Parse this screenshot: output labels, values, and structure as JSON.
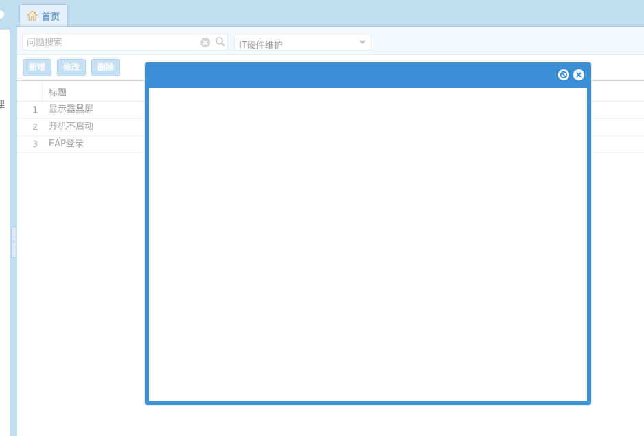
{
  "colors": {
    "accent": "#3a8fd4",
    "tabbar": "#c2dcf0",
    "button": "#c7e0f4"
  },
  "sidebar": {
    "partial_char": "理"
  },
  "tabs": [
    {
      "label": "首页",
      "icon": "home-icon"
    }
  ],
  "search": {
    "placeholder": "问题搜索",
    "value": ""
  },
  "category": {
    "selected": "IT硬件维护"
  },
  "toolbar": {
    "new_label": "新增",
    "edit_label": "修改",
    "delete_label": "删除"
  },
  "grid": {
    "columns": [
      "标题"
    ],
    "rows": [
      {
        "num": "1",
        "title": "显示器黑屏"
      },
      {
        "num": "2",
        "title": "开机不启动"
      },
      {
        "num": "3",
        "title": "EAP登录"
      }
    ]
  },
  "modal": {
    "title": "",
    "buttons": [
      "restore-icon",
      "close-icon"
    ]
  }
}
